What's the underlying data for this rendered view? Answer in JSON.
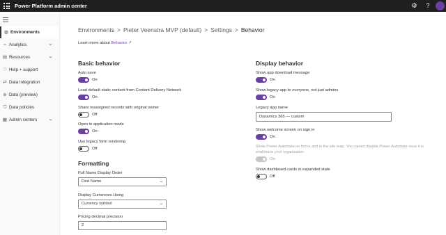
{
  "topbar": {
    "title": "Power Platform admin center",
    "settings_icon": "gear-icon",
    "help_icon": "question-icon",
    "help_glyph": "?",
    "settings_glyph": "⚙"
  },
  "sidebar": {
    "items": [
      {
        "label": "Environments",
        "icon": "globe-icon",
        "glyph": "◎",
        "active": true,
        "expandable": false
      },
      {
        "label": "Analytics",
        "icon": "chart-icon",
        "glyph": "⌁",
        "active": false,
        "expandable": true
      },
      {
        "label": "Resources",
        "icon": "resources-icon",
        "glyph": "▤",
        "active": false,
        "expandable": true
      },
      {
        "label": "Help + support",
        "icon": "headset-icon",
        "glyph": "♡",
        "active": false,
        "expandable": false
      },
      {
        "label": "Data integration",
        "icon": "data-integration-icon",
        "glyph": "⇄",
        "active": false,
        "expandable": false
      },
      {
        "label": "Data (preview)",
        "icon": "data-preview-icon",
        "glyph": "⊛",
        "active": false,
        "expandable": false
      },
      {
        "label": "Data policies",
        "icon": "shield-icon",
        "glyph": "⛉",
        "active": false,
        "expandable": false
      },
      {
        "label": "Admin centers",
        "icon": "admin-centers-icon",
        "glyph": "▦",
        "active": false,
        "expandable": true
      }
    ]
  },
  "breadcrumb": {
    "items": [
      "Environments",
      "Pieter Veenstra MVP (default)",
      "Settings",
      "Behavior"
    ],
    "separator": ">"
  },
  "learn_more": {
    "prefix": "Learn more about",
    "link": "Behavior",
    "icon": "external-link-icon",
    "glyph": "↗"
  },
  "basic": {
    "heading": "Basic behavior",
    "settings": [
      {
        "label": "Auto save",
        "state": "On",
        "on": true
      },
      {
        "label": "Load default static content from Content Delivery Network",
        "state": "On",
        "on": true
      },
      {
        "label": "Share reassigned records with original owner",
        "state": "Off",
        "on": false
      },
      {
        "label": "Open in application mode",
        "state": "On",
        "on": true
      },
      {
        "label": "Use legacy form rendering",
        "state": "Off",
        "on": false
      }
    ]
  },
  "formatting": {
    "heading": "Formatting",
    "full_name": {
      "label": "Full Name Display Order",
      "value": "First Name"
    },
    "currencies": {
      "label": "Display Currencies Using",
      "value": "Currency symbol"
    },
    "precision": {
      "label": "Pricing decimal precision",
      "value": "2"
    }
  },
  "display": {
    "heading": "Display behavior",
    "app_download": {
      "label": "Show app download message",
      "state": "On",
      "on": true
    },
    "legacy_app": {
      "label": "Show legacy app to everyone, not just admins",
      "state": "On",
      "on": true
    },
    "legacy_name": {
      "label": "Legacy app name",
      "value": "Dynamics 365 — custom"
    },
    "welcome": {
      "label": "Show welcome screen on sign in",
      "state": "On",
      "on": true
    },
    "power_automate": {
      "description": "Show Power Automate on forms and in the site map. You cannot disable Power Automate once it is enabled in your organization",
      "state": "On",
      "on": true,
      "disabled": true
    },
    "dashboard_cards": {
      "label": "Show dashboard cards in expanded state",
      "state": "Off",
      "on": false
    }
  },
  "colors": {
    "accent": "#6b3fa0",
    "topbar": "#1f1f1f",
    "sidebar": "#faf9f8"
  }
}
